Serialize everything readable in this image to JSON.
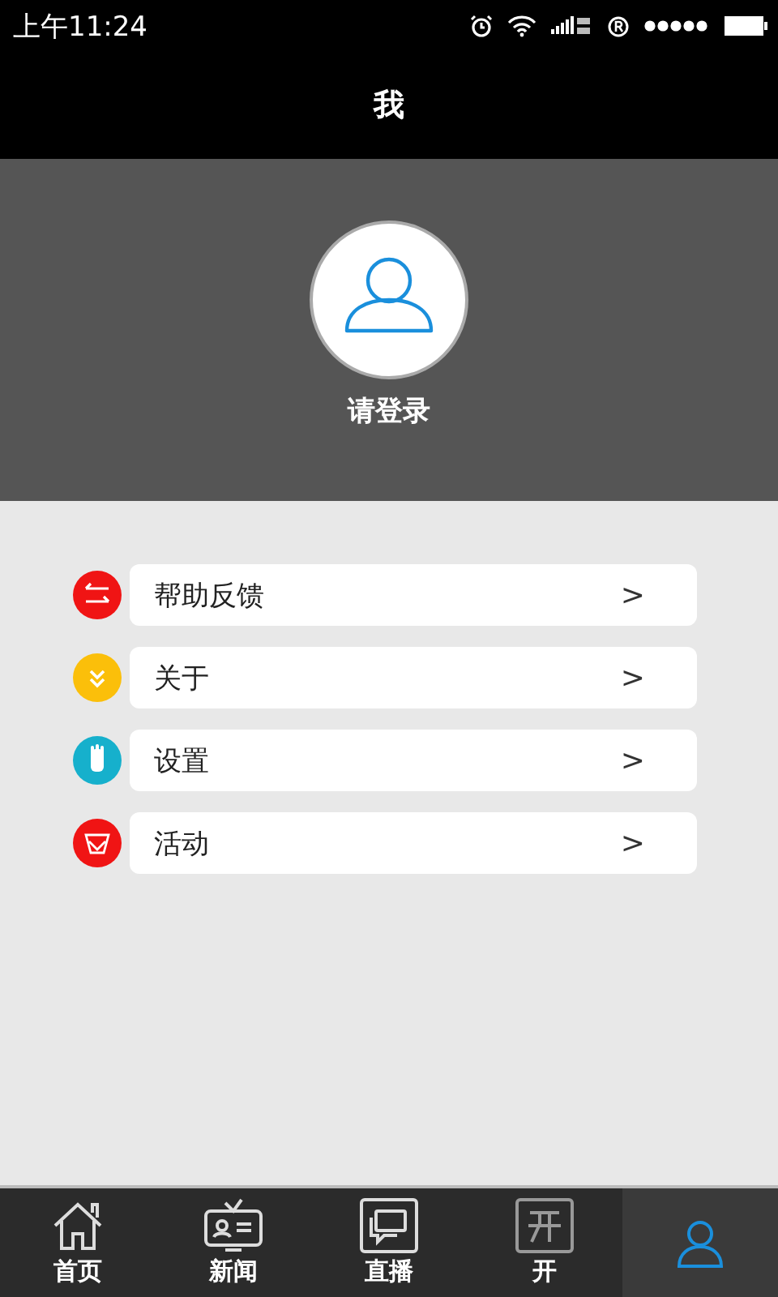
{
  "status_bar": {
    "time": "上午11:24"
  },
  "header": {
    "title": "我"
  },
  "profile": {
    "login_text": "请登录"
  },
  "menu": [
    {
      "label": "帮助反馈",
      "arrow": ">",
      "kind": "swap",
      "color": "#f01414"
    },
    {
      "label": "关于",
      "arrow": ">",
      "kind": "chevrons",
      "color": "#fbbf0a"
    },
    {
      "label": "设置",
      "arrow": ">",
      "kind": "hand",
      "color": "#16b0cc"
    },
    {
      "label": "活动",
      "arrow": ">",
      "kind": "cup",
      "color": "#f01414"
    }
  ],
  "tabs": [
    {
      "label": "首页",
      "kind": "home",
      "selected": false
    },
    {
      "label": "新闻",
      "kind": "tv",
      "selected": false
    },
    {
      "label": "直播",
      "kind": "chat",
      "selected": false
    },
    {
      "label": "开",
      "kind": "box",
      "selected": false
    },
    {
      "kind": "person",
      "selected": true
    }
  ]
}
